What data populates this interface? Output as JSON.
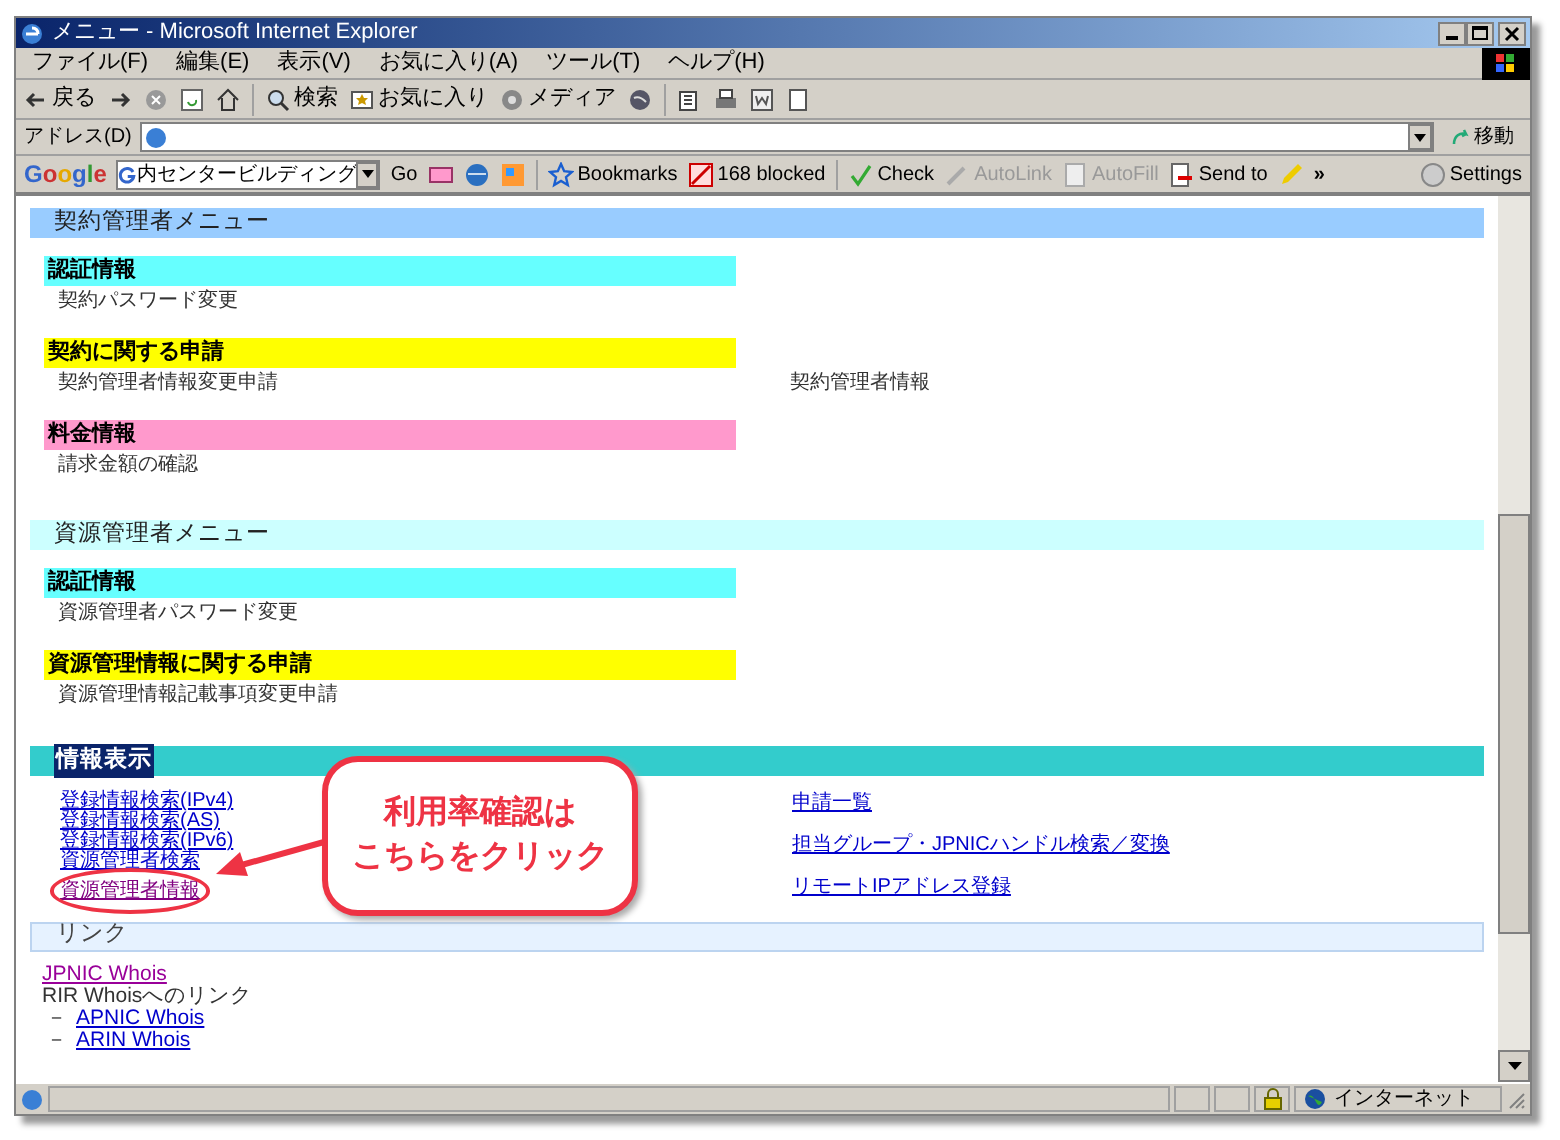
{
  "window": {
    "title": "メニュー - Microsoft Internet Explorer"
  },
  "menu_bar": [
    "ファイル(F)",
    "編集(E)",
    "表示(V)",
    "お気に入り(A)",
    "ツール(T)",
    "ヘルプ(H)"
  ],
  "toolbar": [
    {
      "kind": "back",
      "label": "戻る"
    },
    {
      "kind": "forward"
    },
    {
      "kind": "stop"
    },
    {
      "kind": "refresh"
    },
    {
      "kind": "home"
    },
    {
      "kind": "search",
      "label": "検索"
    },
    {
      "kind": "favorites",
      "label": "お気に入り"
    },
    {
      "kind": "media",
      "label": "メディア"
    },
    {
      "kind": "history"
    },
    {
      "kind": "mail"
    },
    {
      "kind": "print"
    },
    {
      "kind": "edit"
    },
    {
      "kind": "discuss"
    }
  ],
  "address_bar": {
    "label": "アドレス(D)",
    "go": "移動"
  },
  "google_bar": {
    "logo": "Google",
    "search_value": "内センタービルディング",
    "go": "Go",
    "bookmarks": "Bookmarks",
    "blocked": "168 blocked",
    "check": "Check",
    "autolink": "AutoLink",
    "autofill": "AutoFill",
    "send_to": "Send to",
    "more": "»",
    "settings": "Settings"
  },
  "sections": [
    {
      "title": "契約管理者メニュー",
      "color": "#99ccff",
      "groups": [
        {
          "title": "認証情報",
          "color": "#66ffff",
          "items": [
            "契約パスワード変更"
          ]
        },
        {
          "title": "契約に関する申請",
          "color": "#ffff00",
          "items": [
            "契約管理者情報変更申請"
          ],
          "side_items": [
            "契約管理者情報"
          ]
        },
        {
          "title": "料金情報",
          "color": "#ff99cc",
          "items": [
            "請求金額の確認"
          ]
        }
      ]
    },
    {
      "title": "資源管理者メニュー",
      "color": "#ccffff",
      "groups": [
        {
          "title": "認証情報",
          "color": "#66ffff",
          "items": [
            "資源管理者パスワード変更"
          ]
        },
        {
          "title": "資源管理情報に関する申請",
          "color": "#ffff00",
          "items": [
            "資源管理情報記載事項変更申請"
          ]
        }
      ]
    }
  ],
  "info_section": {
    "title": "情報表示",
    "links": [
      {
        "label": "登録情報検索(IPv4)",
        "visited": false
      },
      {
        "label": "登録情報検索(AS)",
        "visited": false
      },
      {
        "label": "登録情報検索(IPv6)",
        "visited": false
      },
      {
        "label": "資源管理者検索",
        "visited": false
      },
      {
        "label": "資源管理者情報",
        "visited": true
      }
    ],
    "side_links": [
      {
        "label": "申請一覧",
        "visited": false
      },
      {
        "label": "担当グループ・JPNICハンドル検索／変換",
        "visited": false
      },
      {
        "label": "リモートIPアドレス登録",
        "visited": false
      }
    ]
  },
  "link_section": {
    "title": "リンク",
    "jpnic_link": {
      "label": "JPNIC Whois",
      "visited": true
    },
    "rir_text": "RIR Whoisへのリンク",
    "rir_links": [
      {
        "bullet": "－",
        "label": "APNIC Whois"
      },
      {
        "bullet": "－",
        "label": "ARIN Whois"
      }
    ]
  },
  "callout": {
    "lines": [
      "利用率確認は",
      "こちらをクリック"
    ]
  },
  "status_bar": {
    "zone": "インターネット"
  }
}
